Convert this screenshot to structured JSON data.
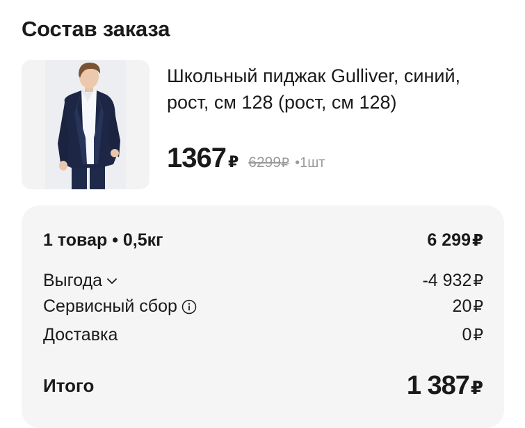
{
  "page": {
    "title": "Состав заказа"
  },
  "product": {
    "name": "Школьный пиджак Gulliver, синий, рост, см 128 (рост, см 128)",
    "price_current": "1367",
    "currency": "₽",
    "price_old": "6299",
    "quantity": "•1шт",
    "image_icon": "boy-in-school-blazer-photo"
  },
  "summary": {
    "items_label": "1 товар • 0,5кг",
    "items_value": "6 299",
    "discount_label": "Выгода",
    "discount_value": "-4 932",
    "service_fee_label": "Сервисный сбор",
    "service_fee_value": "20",
    "delivery_label": "Доставка",
    "delivery_value": "0",
    "total_label": "Итого",
    "total_value": "1 387",
    "currency": "₽"
  },
  "colors": {
    "text": "#1a1a1a",
    "muted": "#9a9a9a",
    "panel_bg": "#f5f5f6",
    "thumb_bg": "#f3f3f4"
  }
}
